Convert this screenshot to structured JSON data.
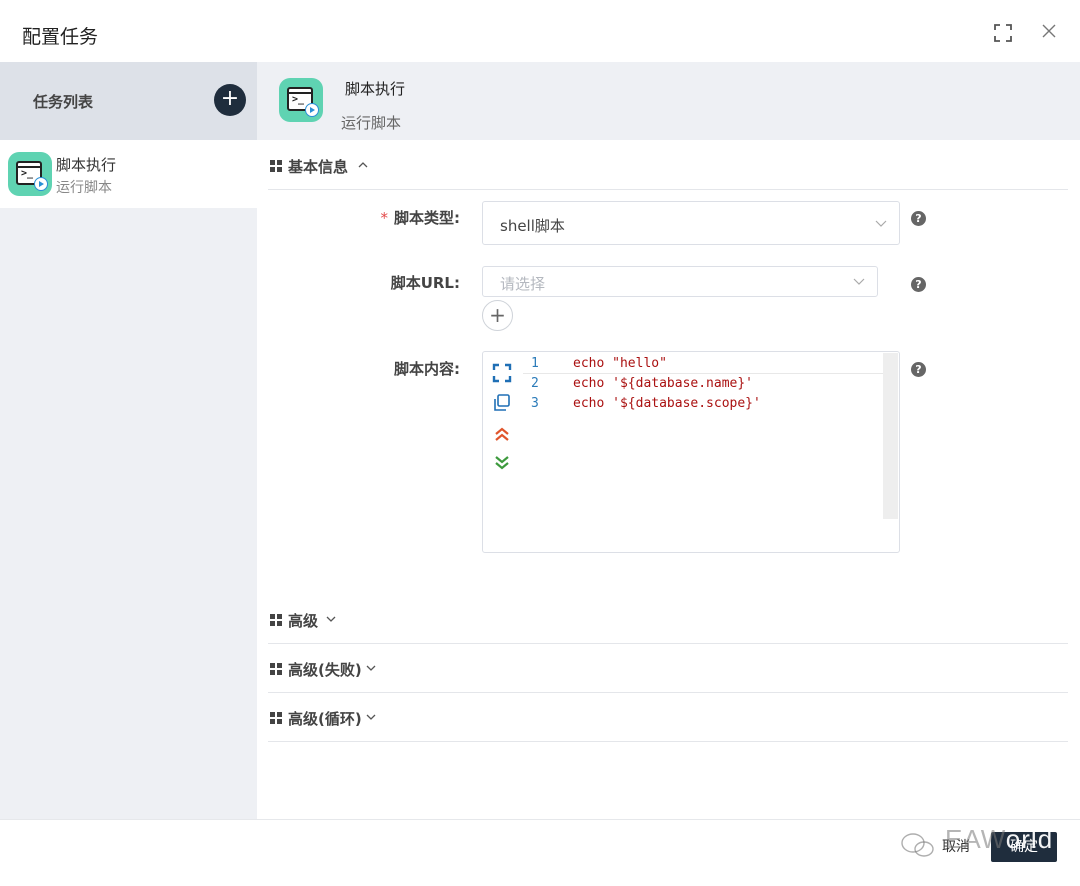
{
  "dialog": {
    "title": "配置任务",
    "fullscreen_icon": "fullscreen-icon",
    "close_icon": "close-icon"
  },
  "sidebar": {
    "header_label": "任务列表",
    "add_icon": "plus-icon",
    "items": [
      {
        "name": "脚本执行",
        "desc": "运行脚本",
        "icon": "terminal-script-icon"
      }
    ]
  },
  "main": {
    "task_name": "脚本执行",
    "task_desc": "运行脚本",
    "sections": [
      {
        "title": "基本信息",
        "expanded": true
      },
      {
        "title": "高级",
        "expanded": false
      },
      {
        "title": "高级(失败)",
        "expanded": false
      },
      {
        "title": "高级(循环)",
        "expanded": false
      }
    ],
    "form": {
      "script_type": {
        "label": "脚本类型:",
        "required_mark": "*",
        "value": "shell脚本"
      },
      "script_url": {
        "label": "脚本URL:",
        "placeholder": "请选择"
      },
      "script_content": {
        "label": "脚本内容:",
        "lines": [
          {
            "no": "1",
            "text": "echo \"hello\""
          },
          {
            "no": "2",
            "text": "echo '${database.name}'"
          },
          {
            "no": "3",
            "text": "echo '${database.scope}'"
          }
        ]
      },
      "help_symbol": "?"
    }
  },
  "footer": {
    "cancel_label": "取消",
    "confirm_label": "确定",
    "watermark_text_gray": "EAW",
    "watermark_text_white": "orld"
  },
  "colors": {
    "dark_button": "#1f2d3d",
    "sidebar_bg": "#eef0f4",
    "icon_teal": "#5fd3b2",
    "code_string": "#aa1111",
    "line_number": "#2b7bb9"
  }
}
